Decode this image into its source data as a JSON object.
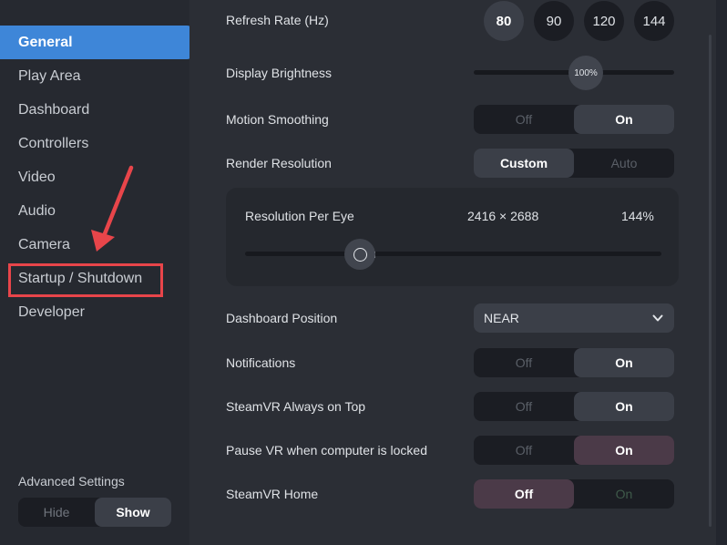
{
  "sidebar": {
    "items": [
      {
        "label": "General"
      },
      {
        "label": "Play Area"
      },
      {
        "label": "Dashboard"
      },
      {
        "label": "Controllers"
      },
      {
        "label": "Video"
      },
      {
        "label": "Audio"
      },
      {
        "label": "Camera"
      },
      {
        "label": "Startup / Shutdown"
      },
      {
        "label": "Developer"
      }
    ],
    "active_index": 0,
    "highlighted_item": "Startup / Shutdown",
    "advanced": {
      "label": "Advanced Settings",
      "options": [
        "Hide",
        "Show"
      ],
      "selected": "Show"
    }
  },
  "settings": {
    "refresh_rate": {
      "label": "Refresh Rate (Hz)",
      "options": [
        "80",
        "90",
        "120",
        "144"
      ],
      "selected": "80"
    },
    "display_brightness": {
      "label": "Display Brightness",
      "value_text": "100%",
      "value": 0.56
    },
    "motion_smoothing": {
      "label": "Motion Smoothing",
      "off_label": "Off",
      "on_label": "On",
      "state": "On"
    },
    "render_resolution": {
      "label": "Render Resolution",
      "custom_label": "Custom",
      "auto_label": "Auto",
      "state": "Custom"
    },
    "resolution_per_eye": {
      "label": "Resolution Per Eye",
      "dims": "2416 × 2688",
      "percent": "144%",
      "value": 0.27
    },
    "dashboard_position": {
      "label": "Dashboard Position",
      "value": "NEAR"
    },
    "notifications": {
      "label": "Notifications",
      "off_label": "Off",
      "on_label": "On",
      "state": "On"
    },
    "always_on_top": {
      "label": "SteamVR Always on Top",
      "off_label": "Off",
      "on_label": "On",
      "state": "On"
    },
    "pause_vr": {
      "label": "Pause VR when computer is locked",
      "off_label": "Off",
      "on_label": "On",
      "state": "On"
    },
    "steamvr_home": {
      "label": "SteamVR Home",
      "off_label": "Off",
      "on_label": "On",
      "state": "Off"
    }
  },
  "colors": {
    "accent": "#3e86d8",
    "highlight": "#e8454a",
    "toggle_pink": "#4b3a48"
  }
}
